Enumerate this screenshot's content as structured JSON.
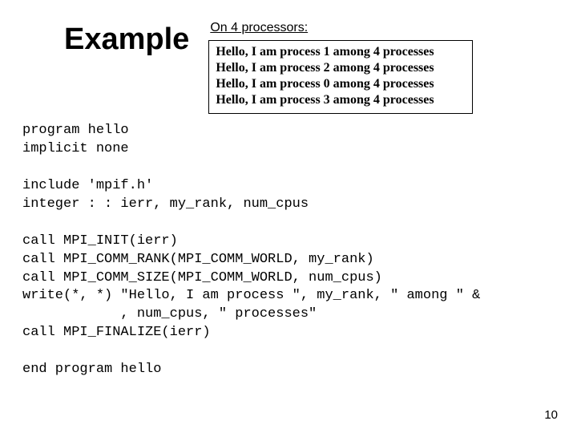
{
  "title": "Example",
  "output": {
    "heading": "On 4 processors:",
    "lines": [
      "Hello, I am process 1 among 4 processes",
      "Hello, I am process 2 among 4 processes",
      "Hello, I am process 0 among 4 processes",
      "Hello, I am process 3 among 4 processes"
    ]
  },
  "code": {
    "l1": "program hello",
    "l2": "implicit none",
    "l3": "",
    "l4": "include 'mpif.h'",
    "l5": "integer : : ierr, my_rank, num_cpus",
    "l6": "",
    "l7": "call MPI_INIT(ierr)",
    "l8": "call MPI_COMM_RANK(MPI_COMM_WORLD, my_rank)",
    "l9": "call MPI_COMM_SIZE(MPI_COMM_WORLD, num_cpus)",
    "l10": "write(*, *) \"Hello, I am process \", my_rank, \" among \" &",
    "l11": "            , num_cpus, \" processes\"",
    "l12": "call MPI_FINALIZE(ierr)",
    "l13": "",
    "l14": "end program hello"
  },
  "page_number": "10"
}
